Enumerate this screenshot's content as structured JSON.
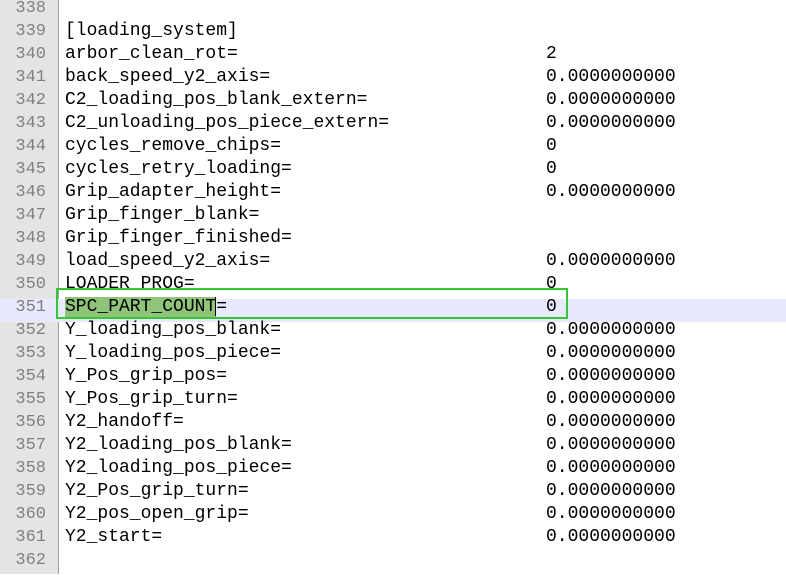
{
  "lines": [
    {
      "n": "338",
      "key": "",
      "val": ""
    },
    {
      "n": "339",
      "key": "[loading_system]",
      "val": ""
    },
    {
      "n": "340",
      "key": "arbor_clean_rot=",
      "val": "2"
    },
    {
      "n": "341",
      "key": "back_speed_y2_axis=",
      "val": "0.0000000000"
    },
    {
      "n": "342",
      "key": "C2_loading_pos_blank_extern=",
      "val": "0.0000000000"
    },
    {
      "n": "343",
      "key": "C2_unloading_pos_piece_extern=",
      "val": "0.0000000000"
    },
    {
      "n": "344",
      "key": "cycles_remove_chips=",
      "val": "0"
    },
    {
      "n": "345",
      "key": "cycles_retry_loading=",
      "val": "0"
    },
    {
      "n": "346",
      "key": "Grip_adapter_height=",
      "val": "0.0000000000"
    },
    {
      "n": "347",
      "key": "Grip_finger_blank=",
      "val": ""
    },
    {
      "n": "348",
      "key": "Grip_finger_finished=",
      "val": ""
    },
    {
      "n": "349",
      "key": "load_speed_y2_axis=",
      "val": "0.0000000000"
    },
    {
      "n": "350",
      "key": "LOADER_PROG=",
      "val": "0"
    },
    {
      "n": "351",
      "key": "SPC_PART_COUNT=",
      "val": "0",
      "selected": "SPC_PART_COUNT",
      "rest": "="
    },
    {
      "n": "352",
      "key": "Y_loading_pos_blank=",
      "val": "0.0000000000"
    },
    {
      "n": "353",
      "key": "Y_loading_pos_piece=",
      "val": "0.0000000000"
    },
    {
      "n": "354",
      "key": "Y_Pos_grip_pos=",
      "val": "0.0000000000"
    },
    {
      "n": "355",
      "key": "Y_Pos_grip_turn=",
      "val": "0.0000000000"
    },
    {
      "n": "356",
      "key": "Y2_handoff=",
      "val": "0.0000000000"
    },
    {
      "n": "357",
      "key": "Y2_loading_pos_blank=",
      "val": "0.0000000000"
    },
    {
      "n": "358",
      "key": "Y2_loading_pos_piece=",
      "val": "0.0000000000"
    },
    {
      "n": "359",
      "key": "Y2_Pos_grip_turn=",
      "val": "0.0000000000"
    },
    {
      "n": "360",
      "key": "Y2_pos_open_grip=",
      "val": "0.0000000000"
    },
    {
      "n": "361",
      "key": "Y2_start=",
      "val": "0.0000000000"
    },
    {
      "n": "362",
      "key": "",
      "val": ""
    }
  ],
  "colors": {
    "selection": "#8fc47a",
    "current_line": "#e8e8ff",
    "highlight_box": "#32c832",
    "gutter": "#e4e4e4"
  }
}
